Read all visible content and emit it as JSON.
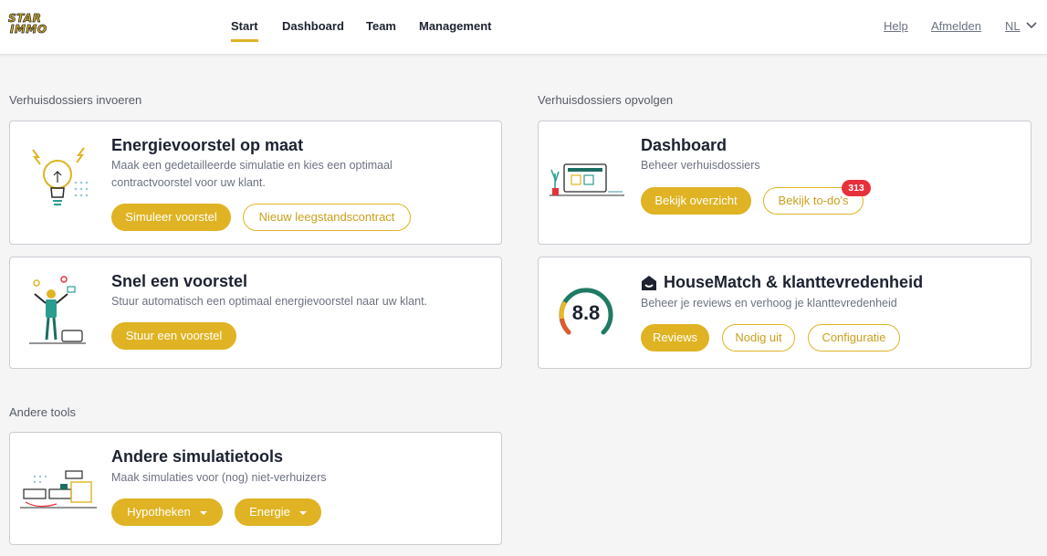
{
  "header": {
    "logo_line1": "STAR",
    "logo_line2": "IMMO",
    "nav": [
      "Start",
      "Dashboard",
      "Team",
      "Management"
    ],
    "help": "Help",
    "logout": "Afmelden",
    "language": "NL"
  },
  "sections": {
    "left_title": "Verhuisdossiers invoeren",
    "right_title": "Verhuisdossiers opvolgen",
    "other_title": "Andere tools"
  },
  "cards": {
    "energie": {
      "title": "Energievoorstel op maat",
      "desc_line1": "Maak een gedetailleerde simulatie en kies een optimaal",
      "desc_line2": "contractvoorstel voor uw klant.",
      "btn_simulate": "Simuleer voorstel",
      "btn_new": "Nieuw leegstandscontract"
    },
    "snel": {
      "title": "Snel een voorstel",
      "desc": "Stuur automatisch een optimaal energievoorstel naar uw klant.",
      "btn_send": "Stuur een voorstel"
    },
    "dashboard": {
      "title": "Dashboard",
      "desc": "Beheer verhuisdossiers",
      "btn_overview": "Bekijk overzicht",
      "btn_todos": "Bekijk to-do's",
      "todo_count": "313"
    },
    "housematch": {
      "title": "HouseMatch & klanttevredenheid",
      "desc": "Beheer je reviews en verhoog je klanttevredenheid",
      "score": "8.8",
      "btn_reviews": "Reviews",
      "btn_invite": "Nodig uit",
      "btn_config": "Configuratie"
    },
    "tools": {
      "title": "Andere simulatietools",
      "desc": "Maak simulaties voor (nog) niet-verhuizers",
      "btn_mortgage": "Hypotheken",
      "btn_energy": "Energie"
    }
  },
  "colors": {
    "accent": "#dfb323",
    "badge": "#e6303a",
    "gauge_green": "#1f7a63",
    "gauge_yellow": "#e8b828",
    "gauge_red": "#e05a2b"
  }
}
